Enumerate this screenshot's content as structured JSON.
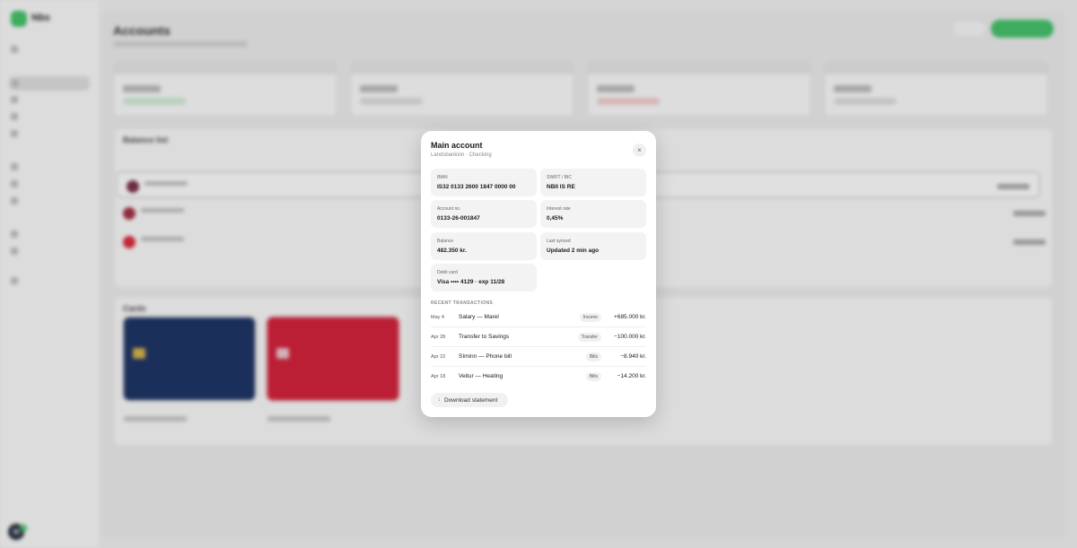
{
  "app": {
    "logo_text": "Nbs",
    "page_title": "Accounts",
    "panel_titles": {
      "balances": "Balance list",
      "cards": "Cards"
    },
    "avatar_initial": "N"
  },
  "modal": {
    "title": "Main account",
    "subtitle": "Landsbankinn · Checking",
    "close_icon": "×",
    "fields": [
      {
        "label": "IBAN",
        "value": "IS32 0133 2600 1847 0000 00"
      },
      {
        "label": "SWIFT / BIC",
        "value": "NBII IS RE"
      },
      {
        "label": "Account no.",
        "value": "0133-26-001847"
      },
      {
        "label": "Interest rate",
        "value": "0,45%"
      },
      {
        "label": "Balance",
        "value": "482.350 kr."
      },
      {
        "label": "Last synced",
        "value": "Updated 2 min ago"
      },
      {
        "label": "Debit card",
        "value": "Visa •••• 4129 · exp 11/28"
      }
    ],
    "transactions_label": "RECENT TRANSACTIONS",
    "transactions": [
      {
        "date": "May 4",
        "description": "Salary — Marel",
        "tag": "Income",
        "amount": "+685.000 kr."
      },
      {
        "date": "Apr 28",
        "description": "Transfer to Savings",
        "tag": "Transfer",
        "amount": "−100.000 kr."
      },
      {
        "date": "Apr 22",
        "description": "Síminn — Phone bill",
        "tag": "Bills",
        "amount": "−8.940 kr."
      },
      {
        "date": "Apr 18",
        "description": "Veitur — Heating",
        "tag": "Bills",
        "amount": "−14.200 kr."
      }
    ],
    "download_label": "Download statement",
    "download_icon": "↓"
  }
}
